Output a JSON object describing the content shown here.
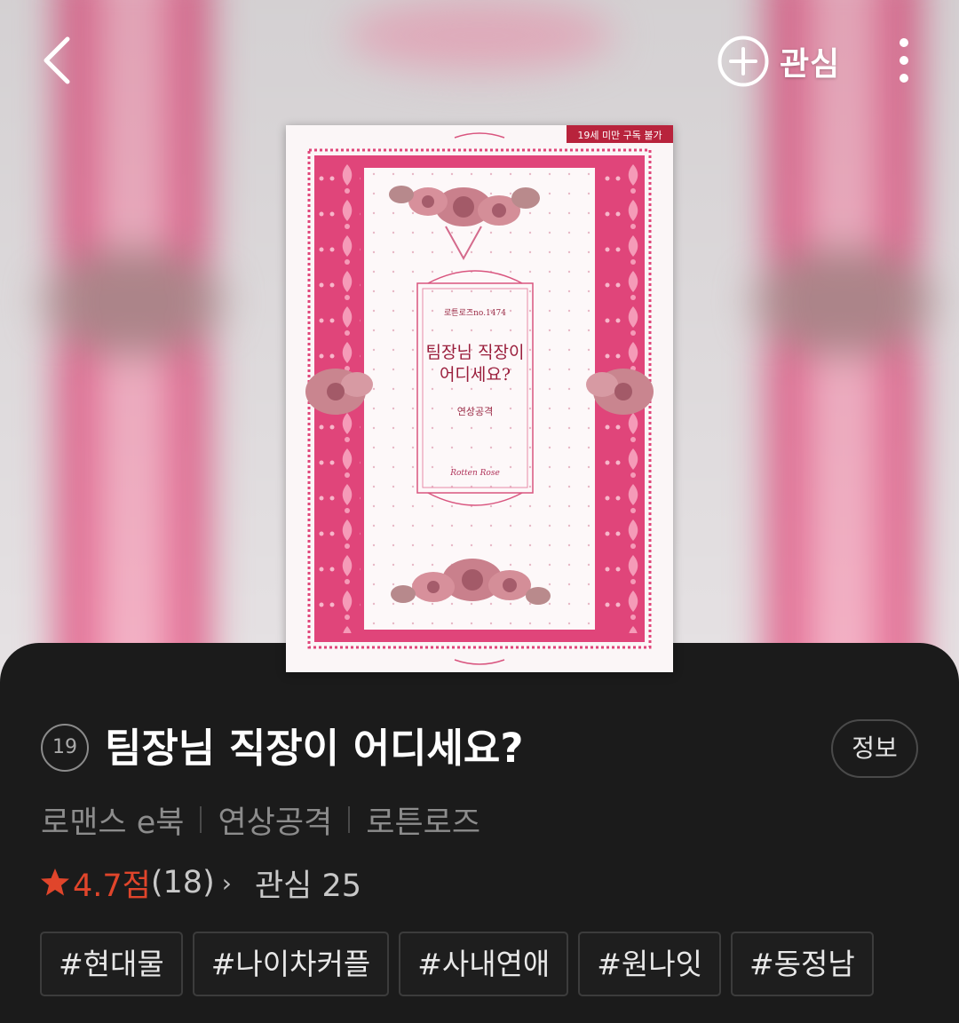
{
  "header": {
    "follow_label": "관심"
  },
  "cover": {
    "ribbon": "19세 미만 구독 불가",
    "series": "로튼로즈no.1474",
    "title_line1": "팀장님 직장이",
    "title_line2": "어디세요?",
    "author": "연상공격",
    "publisher_logo": "Rotten Rose"
  },
  "book": {
    "age_rating": "19",
    "title": "팀장님 직장이 어디세요?",
    "info_label": "정보",
    "genre": "로맨스 e북",
    "author": "연상공격",
    "publisher": "로튼로즈"
  },
  "stats": {
    "rating": "4.7점",
    "rating_count": "(18)",
    "favorites": "관심 25"
  },
  "tags": [
    "#현대물",
    "#나이차커플",
    "#사내연애",
    "#원나잇",
    "#동정남"
  ],
  "colors": {
    "accent_red": "#e0452b",
    "cover_pink": "#e0457a",
    "sheet_bg": "#1b1b1b"
  },
  "icons": [
    "chevron-left-icon",
    "plus-circle-icon",
    "more-vertical-icon",
    "star-icon",
    "chevron-right-icon"
  ]
}
